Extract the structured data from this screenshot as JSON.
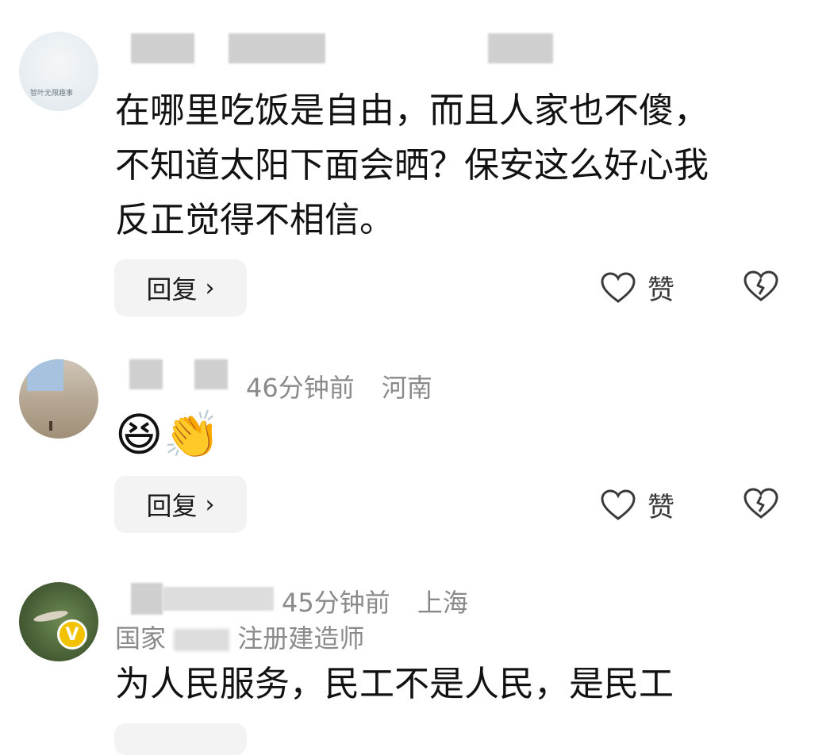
{
  "comments": [
    {
      "avatar_caption": "智叶无限趣事",
      "text_lines": [
        "在哪里吃饭是自由，而且人家也不傻，",
        "不知道太阳下面会晒？保安这么好心我",
        "反正觉得不相信。"
      ],
      "reply_label": "回复",
      "like_label": "赞"
    },
    {
      "time": "46分钟前",
      "location": "河南",
      "emojis": [
        "😆",
        "👏"
      ],
      "reply_label": "回复",
      "like_label": "赞"
    },
    {
      "time": "45分钟前",
      "location": "上海",
      "badge": "V",
      "title_left": "国家",
      "title_right": "注册建造师",
      "text": "为人民服务，民工不是人民，是民工"
    }
  ],
  "colors": {
    "meta": "#8a8a8a",
    "button_bg": "#f3f3f3",
    "badge": "#f2c200"
  },
  "icons": [
    "heart-outline-icon",
    "broken-heart-icon",
    "chevron-right-icon",
    "verified-v-badge-icon"
  ]
}
